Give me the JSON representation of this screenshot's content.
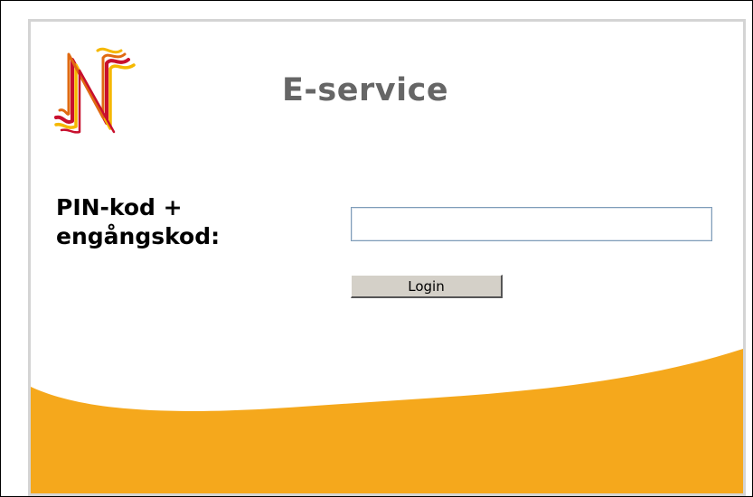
{
  "header": {
    "title": "E-service",
    "logo_icon": "n-logo-icon"
  },
  "login_form": {
    "label_line1": "PIN-kod +",
    "label_line2": "engångskod:",
    "pin_value": "",
    "pin_placeholder": "",
    "login_label": "Login"
  },
  "colors": {
    "accent_orange": "#f5a81c",
    "logo_red": "#c8102e",
    "logo_yellow": "#f5b800",
    "title_gray": "#666666"
  }
}
